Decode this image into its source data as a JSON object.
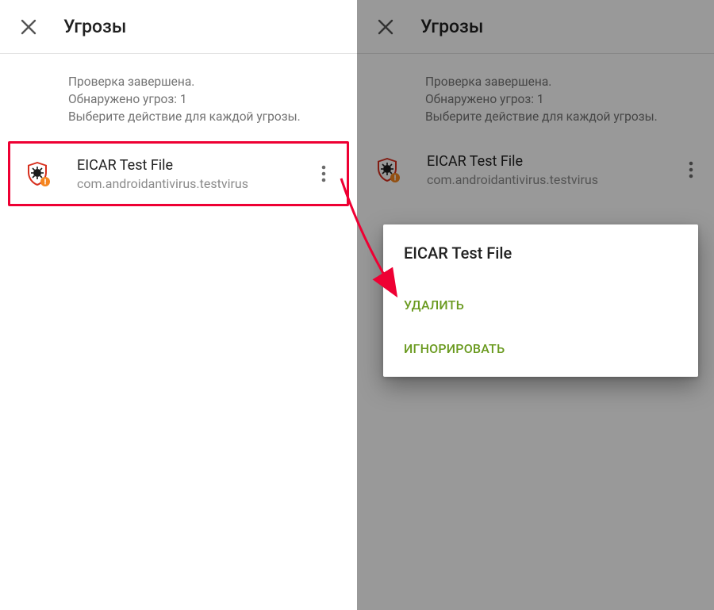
{
  "colors": {
    "accent_green": "#6a9a1f",
    "highlight_red": "#e03"
  },
  "left": {
    "title": "Угрозы",
    "summary": {
      "line1": "Проверка завершена.",
      "line2": "Обнаружено угроз: 1",
      "line3": "Выберите действие для каждой угрозы."
    },
    "threat": {
      "name": "EICAR Test File",
      "package": "com.androidantivirus.testvirus"
    }
  },
  "right": {
    "title": "Угрозы",
    "summary": {
      "line1": "Проверка завершена.",
      "line2": "Обнаружено угроз: 1",
      "line3": "Выберите действие для каждой угрозы."
    },
    "threat": {
      "name": "EICAR Test File",
      "package": "com.androidantivirus.testvirus"
    },
    "menu": {
      "title": "EICAR Test File",
      "delete": "УДАЛИТЬ",
      "ignore": "ИГНОРИРОВАТЬ"
    }
  }
}
